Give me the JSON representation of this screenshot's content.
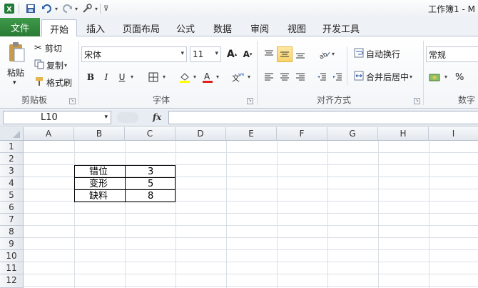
{
  "window": {
    "title": "工作簿1 - M"
  },
  "tabs": {
    "file": "文件",
    "home": "开始",
    "insert": "插入",
    "page_layout": "页面布局",
    "formulas": "公式",
    "data": "数据",
    "review": "审阅",
    "view": "视图",
    "developer": "开发工具"
  },
  "clipboard": {
    "paste": "粘贴",
    "cut": "剪切",
    "copy": "复制",
    "format_painter": "格式刷",
    "group": "剪贴板"
  },
  "font": {
    "name": "宋体",
    "size": "11",
    "group": "字体"
  },
  "alignment": {
    "wrap": "自动换行",
    "merge": "合并后居中",
    "group": "对齐方式"
  },
  "number": {
    "format": "常规",
    "group": "数字",
    "percent": "%"
  },
  "formula_bar": {
    "name_box": "L10",
    "fx": "fx"
  },
  "columns": [
    "A",
    "B",
    "C",
    "D",
    "E",
    "F",
    "G",
    "H",
    "I"
  ],
  "rows": [
    "1",
    "2",
    "3",
    "4",
    "5",
    "6",
    "7",
    "8",
    "9",
    "10",
    "11",
    "12"
  ],
  "cells": {
    "b3": "错位",
    "c3": "3",
    "b4": "变形",
    "c4": "5",
    "b5": "缺料",
    "c5": "8"
  }
}
